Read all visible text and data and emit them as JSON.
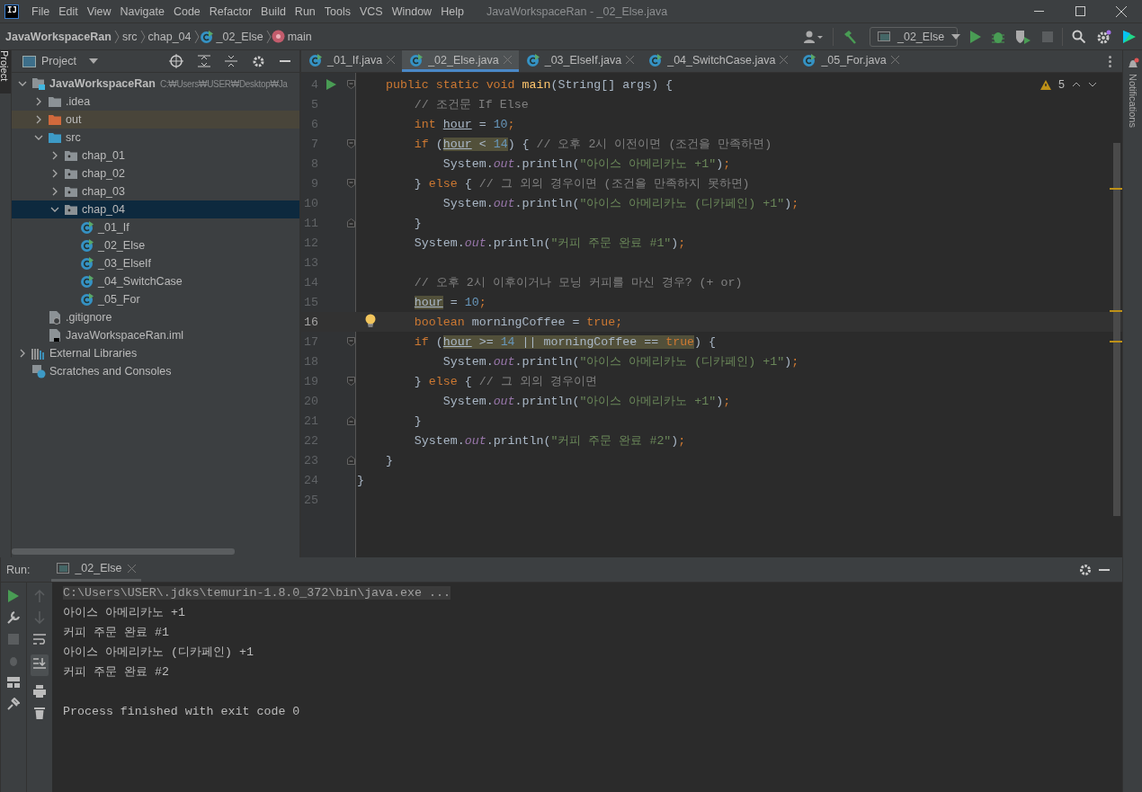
{
  "title_bar": {
    "logo": "IJ",
    "menu": [
      "File",
      "Edit",
      "View",
      "Navigate",
      "Code",
      "Refactor",
      "Build",
      "Run",
      "Tools",
      "VCS",
      "Window",
      "Help"
    ],
    "title": "JavaWorkspaceRan - _02_Else.java"
  },
  "nav_bar": {
    "breadcrumbs": [
      {
        "label": "JavaWorkspaceRan",
        "kind": "project"
      },
      {
        "label": "src",
        "kind": "folder"
      },
      {
        "label": "chap_04",
        "kind": "folder"
      },
      {
        "label": "_02_Else",
        "kind": "class"
      },
      {
        "label": "main",
        "kind": "method"
      }
    ],
    "run_config": "_02_Else"
  },
  "left_strip": {
    "tab": "Project"
  },
  "project_panel": {
    "title": "Project",
    "tree": [
      {
        "label": "JavaWorkspaceRan",
        "path": "C:₩Users₩USER₩Desktop₩Ja",
        "kind": "project",
        "expanded": true,
        "selected": false,
        "children": [
          {
            "label": ".idea",
            "kind": "folder",
            "expanded": false,
            "selected": false
          },
          {
            "label": "out",
            "kind": "excluded-folder",
            "expanded": false,
            "selected": false
          },
          {
            "label": "src",
            "kind": "source-folder",
            "expanded": true,
            "selected": false,
            "children": [
              {
                "label": "chap_01",
                "kind": "package",
                "expanded": false,
                "selected": false
              },
              {
                "label": "chap_02",
                "kind": "package",
                "expanded": false,
                "selected": false
              },
              {
                "label": "chap_03",
                "kind": "package",
                "expanded": false,
                "selected": false
              },
              {
                "label": "chap_04",
                "kind": "package",
                "expanded": true,
                "selected": true,
                "children": [
                  {
                    "label": "_01_If",
                    "kind": "class",
                    "selected": false
                  },
                  {
                    "label": "_02_Else",
                    "kind": "class",
                    "selected": false
                  },
                  {
                    "label": "_03_ElseIf",
                    "kind": "class",
                    "selected": false
                  },
                  {
                    "label": "_04_SwitchCase",
                    "kind": "class",
                    "selected": false
                  },
                  {
                    "label": "_05_For",
                    "kind": "class",
                    "selected": false
                  }
                ]
              }
            ]
          },
          {
            "label": ".gitignore",
            "kind": "ignore-file",
            "selected": false
          },
          {
            "label": "JavaWorkspaceRan.iml",
            "kind": "module-file",
            "selected": false
          }
        ]
      },
      {
        "label": "External Libraries",
        "kind": "libraries",
        "expanded": false,
        "selected": false
      },
      {
        "label": "Scratches and Consoles",
        "kind": "scratches",
        "selected": false
      }
    ]
  },
  "editor": {
    "tabs": [
      {
        "label": "_01_If.java",
        "selected": false
      },
      {
        "label": "_02_Else.java",
        "selected": true
      },
      {
        "label": "_03_ElseIf.java",
        "selected": false
      },
      {
        "label": "_04_SwitchCase.java",
        "selected": false
      },
      {
        "label": "_05_For.java",
        "selected": false
      }
    ],
    "warning_count": "5",
    "lines": [
      {
        "number": "4",
        "current": false,
        "markers": [
          {
            "kind": "run"
          },
          {
            "kind": "fold"
          }
        ],
        "tokens": [
          {
            "t": "    public static void ",
            "kind": "keyword"
          },
          {
            "t": "main",
            "kind": "method"
          },
          {
            "t": "(String[] args) {",
            "kind": "plain"
          }
        ]
      },
      {
        "number": "5",
        "current": false,
        "tokens": [
          {
            "t": "        // 조건문 If Else",
            "kind": "comment"
          }
        ]
      },
      {
        "number": "6",
        "current": false,
        "tokens": [
          {
            "t": "        int ",
            "kind": "keyword"
          },
          {
            "t": "hour",
            "kind": "variable"
          },
          {
            "t": " = ",
            "kind": "plain"
          },
          {
            "t": "10",
            "kind": "number"
          },
          {
            "t": ";",
            "kind": "keyword"
          }
        ]
      },
      {
        "number": "7",
        "current": false,
        "markers": [
          {
            "kind": "fold"
          }
        ],
        "tokens": [
          {
            "t": "        if ",
            "kind": "keyword"
          },
          {
            "t": "(",
            "kind": "plain"
          },
          {
            "t": "hour",
            "kind": "variable",
            "highlighted": true
          },
          {
            "t": " < ",
            "kind": "plain",
            "highlighted": true
          },
          {
            "t": "14",
            "kind": "number",
            "highlighted": true
          },
          {
            "t": ") { ",
            "kind": "plain"
          },
          {
            "t": "// 오후 2시 이전이면 (조건을 만족하면)",
            "kind": "comment"
          }
        ]
      },
      {
        "number": "8",
        "current": false,
        "tokens": [
          {
            "t": "            System.",
            "kind": "plain"
          },
          {
            "t": "out",
            "kind": "field"
          },
          {
            "t": ".println(",
            "kind": "plain"
          },
          {
            "t": "\"아이스 아메리카노 +1\"",
            "kind": "string"
          },
          {
            "t": ")",
            "kind": "plain"
          },
          {
            "t": ";",
            "kind": "keyword"
          }
        ]
      },
      {
        "number": "9",
        "current": false,
        "markers": [
          {
            "kind": "fold"
          }
        ],
        "tokens": [
          {
            "t": "        } ",
            "kind": "plain"
          },
          {
            "t": "else ",
            "kind": "keyword"
          },
          {
            "t": "{ ",
            "kind": "plain"
          },
          {
            "t": "// 그 외의 경우이면 (조건을 만족하지 못하면)",
            "kind": "comment"
          }
        ]
      },
      {
        "number": "10",
        "current": false,
        "tokens": [
          {
            "t": "            System.",
            "kind": "plain"
          },
          {
            "t": "out",
            "kind": "field"
          },
          {
            "t": ".println(",
            "kind": "plain"
          },
          {
            "t": "\"아이스 아메리카노 (디카페인) +1\"",
            "kind": "string"
          },
          {
            "t": ")",
            "kind": "plain"
          },
          {
            "t": ";",
            "kind": "keyword"
          }
        ]
      },
      {
        "number": "11",
        "current": false,
        "markers": [
          {
            "kind": "fold-end"
          }
        ],
        "tokens": [
          {
            "t": "        }",
            "kind": "plain"
          }
        ]
      },
      {
        "number": "12",
        "current": false,
        "tokens": [
          {
            "t": "        System.",
            "kind": "plain"
          },
          {
            "t": "out",
            "kind": "field"
          },
          {
            "t": ".println(",
            "kind": "plain"
          },
          {
            "t": "\"커피 주문 완료 #1\"",
            "kind": "string"
          },
          {
            "t": ")",
            "kind": "plain"
          },
          {
            "t": ";",
            "kind": "keyword"
          }
        ]
      },
      {
        "number": "13",
        "current": false
      },
      {
        "number": "14",
        "current": false,
        "tokens": [
          {
            "t": "        // 오후 2시 이후이거나 모닝 커피를 마신 경우? (+ or)",
            "kind": "comment"
          }
        ]
      },
      {
        "number": "15",
        "current": false,
        "tokens": [
          {
            "t": "        hour",
            "kind": "variable",
            "highlighted": true
          },
          {
            "t": " = ",
            "kind": "plain"
          },
          {
            "t": "10",
            "kind": "number"
          },
          {
            "t": ";",
            "kind": "keyword"
          }
        ]
      },
      {
        "number": "16",
        "current": true,
        "markers": [
          {
            "kind": "bulb"
          }
        ],
        "tokens": [
          {
            "t": "        boolean ",
            "kind": "keyword"
          },
          {
            "t": "morningCoffee = ",
            "kind": "plain"
          },
          {
            "t": "true",
            "kind": "keyword"
          },
          {
            "t": ";",
            "kind": "keyword"
          }
        ]
      },
      {
        "number": "17",
        "current": false,
        "markers": [
          {
            "kind": "fold"
          }
        ],
        "tokens": [
          {
            "t": "        if ",
            "kind": "keyword"
          },
          {
            "t": "(",
            "kind": "plain"
          },
          {
            "t": "hour",
            "kind": "variable",
            "highlighted": true
          },
          {
            "t": " >= ",
            "kind": "plain",
            "highlighted": true
          },
          {
            "t": "14",
            "kind": "number",
            "highlighted": true
          },
          {
            "t": " || morningCoffee == ",
            "kind": "plain",
            "highlighted": true
          },
          {
            "t": "true",
            "kind": "keyword",
            "highlighted": true
          },
          {
            "t": ") {",
            "kind": "plain"
          }
        ]
      },
      {
        "number": "18",
        "current": false,
        "tokens": [
          {
            "t": "            System.",
            "kind": "plain"
          },
          {
            "t": "out",
            "kind": "field"
          },
          {
            "t": ".println(",
            "kind": "plain"
          },
          {
            "t": "\"아이스 아메리카노 (디카페인) +1\"",
            "kind": "string"
          },
          {
            "t": ")",
            "kind": "plain"
          },
          {
            "t": ";",
            "kind": "keyword"
          }
        ]
      },
      {
        "number": "19",
        "current": false,
        "markers": [
          {
            "kind": "fold"
          }
        ],
        "tokens": [
          {
            "t": "        } ",
            "kind": "plain"
          },
          {
            "t": "else ",
            "kind": "keyword"
          },
          {
            "t": "{ ",
            "kind": "plain"
          },
          {
            "t": "// 그 외의 경우이면",
            "kind": "comment"
          }
        ]
      },
      {
        "number": "20",
        "current": false,
        "tokens": [
          {
            "t": "            System.",
            "kind": "plain"
          },
          {
            "t": "out",
            "kind": "field"
          },
          {
            "t": ".println(",
            "kind": "plain"
          },
          {
            "t": "\"아이스 아메리카노 +1\"",
            "kind": "string"
          },
          {
            "t": ")",
            "kind": "plain"
          },
          {
            "t": ";",
            "kind": "keyword"
          }
        ]
      },
      {
        "number": "21",
        "current": false,
        "markers": [
          {
            "kind": "fold-end"
          }
        ],
        "tokens": [
          {
            "t": "        }",
            "kind": "plain"
          }
        ]
      },
      {
        "number": "22",
        "current": false,
        "tokens": [
          {
            "t": "        System.",
            "kind": "plain"
          },
          {
            "t": "out",
            "kind": "field"
          },
          {
            "t": ".println(",
            "kind": "plain"
          },
          {
            "t": "\"커피 주문 완료 #2\"",
            "kind": "string"
          },
          {
            "t": ")",
            "kind": "plain"
          },
          {
            "t": ";",
            "kind": "keyword"
          }
        ]
      },
      {
        "number": "23",
        "current": false,
        "markers": [
          {
            "kind": "fold-end"
          }
        ],
        "tokens": [
          {
            "t": "    }",
            "kind": "plain"
          }
        ]
      },
      {
        "number": "24",
        "current": false,
        "tokens": [
          {
            "t": "}",
            "kind": "plain"
          }
        ]
      },
      {
        "number": "25",
        "current": false
      }
    ]
  },
  "right_strip": {
    "tab": "Notifications"
  },
  "run_panel": {
    "label": "Run:",
    "tab": "_02_Else",
    "console": [
      {
        "text": "C:\\Users\\USER\\.jdks\\temurin-1.8.0_372\\bin\\java.exe ...",
        "kind": "command"
      },
      {
        "text": "아이스 아메리카노 +1",
        "kind": "output"
      },
      {
        "text": "커피 주문 완료 #1",
        "kind": "output"
      },
      {
        "text": "아이스 아메리카노 (디카페인) +1",
        "kind": "output"
      },
      {
        "text": "커피 주문 완료 #2",
        "kind": "output"
      },
      {
        "text": "Process finished with exit code 0",
        "kind": "exit"
      }
    ]
  }
}
